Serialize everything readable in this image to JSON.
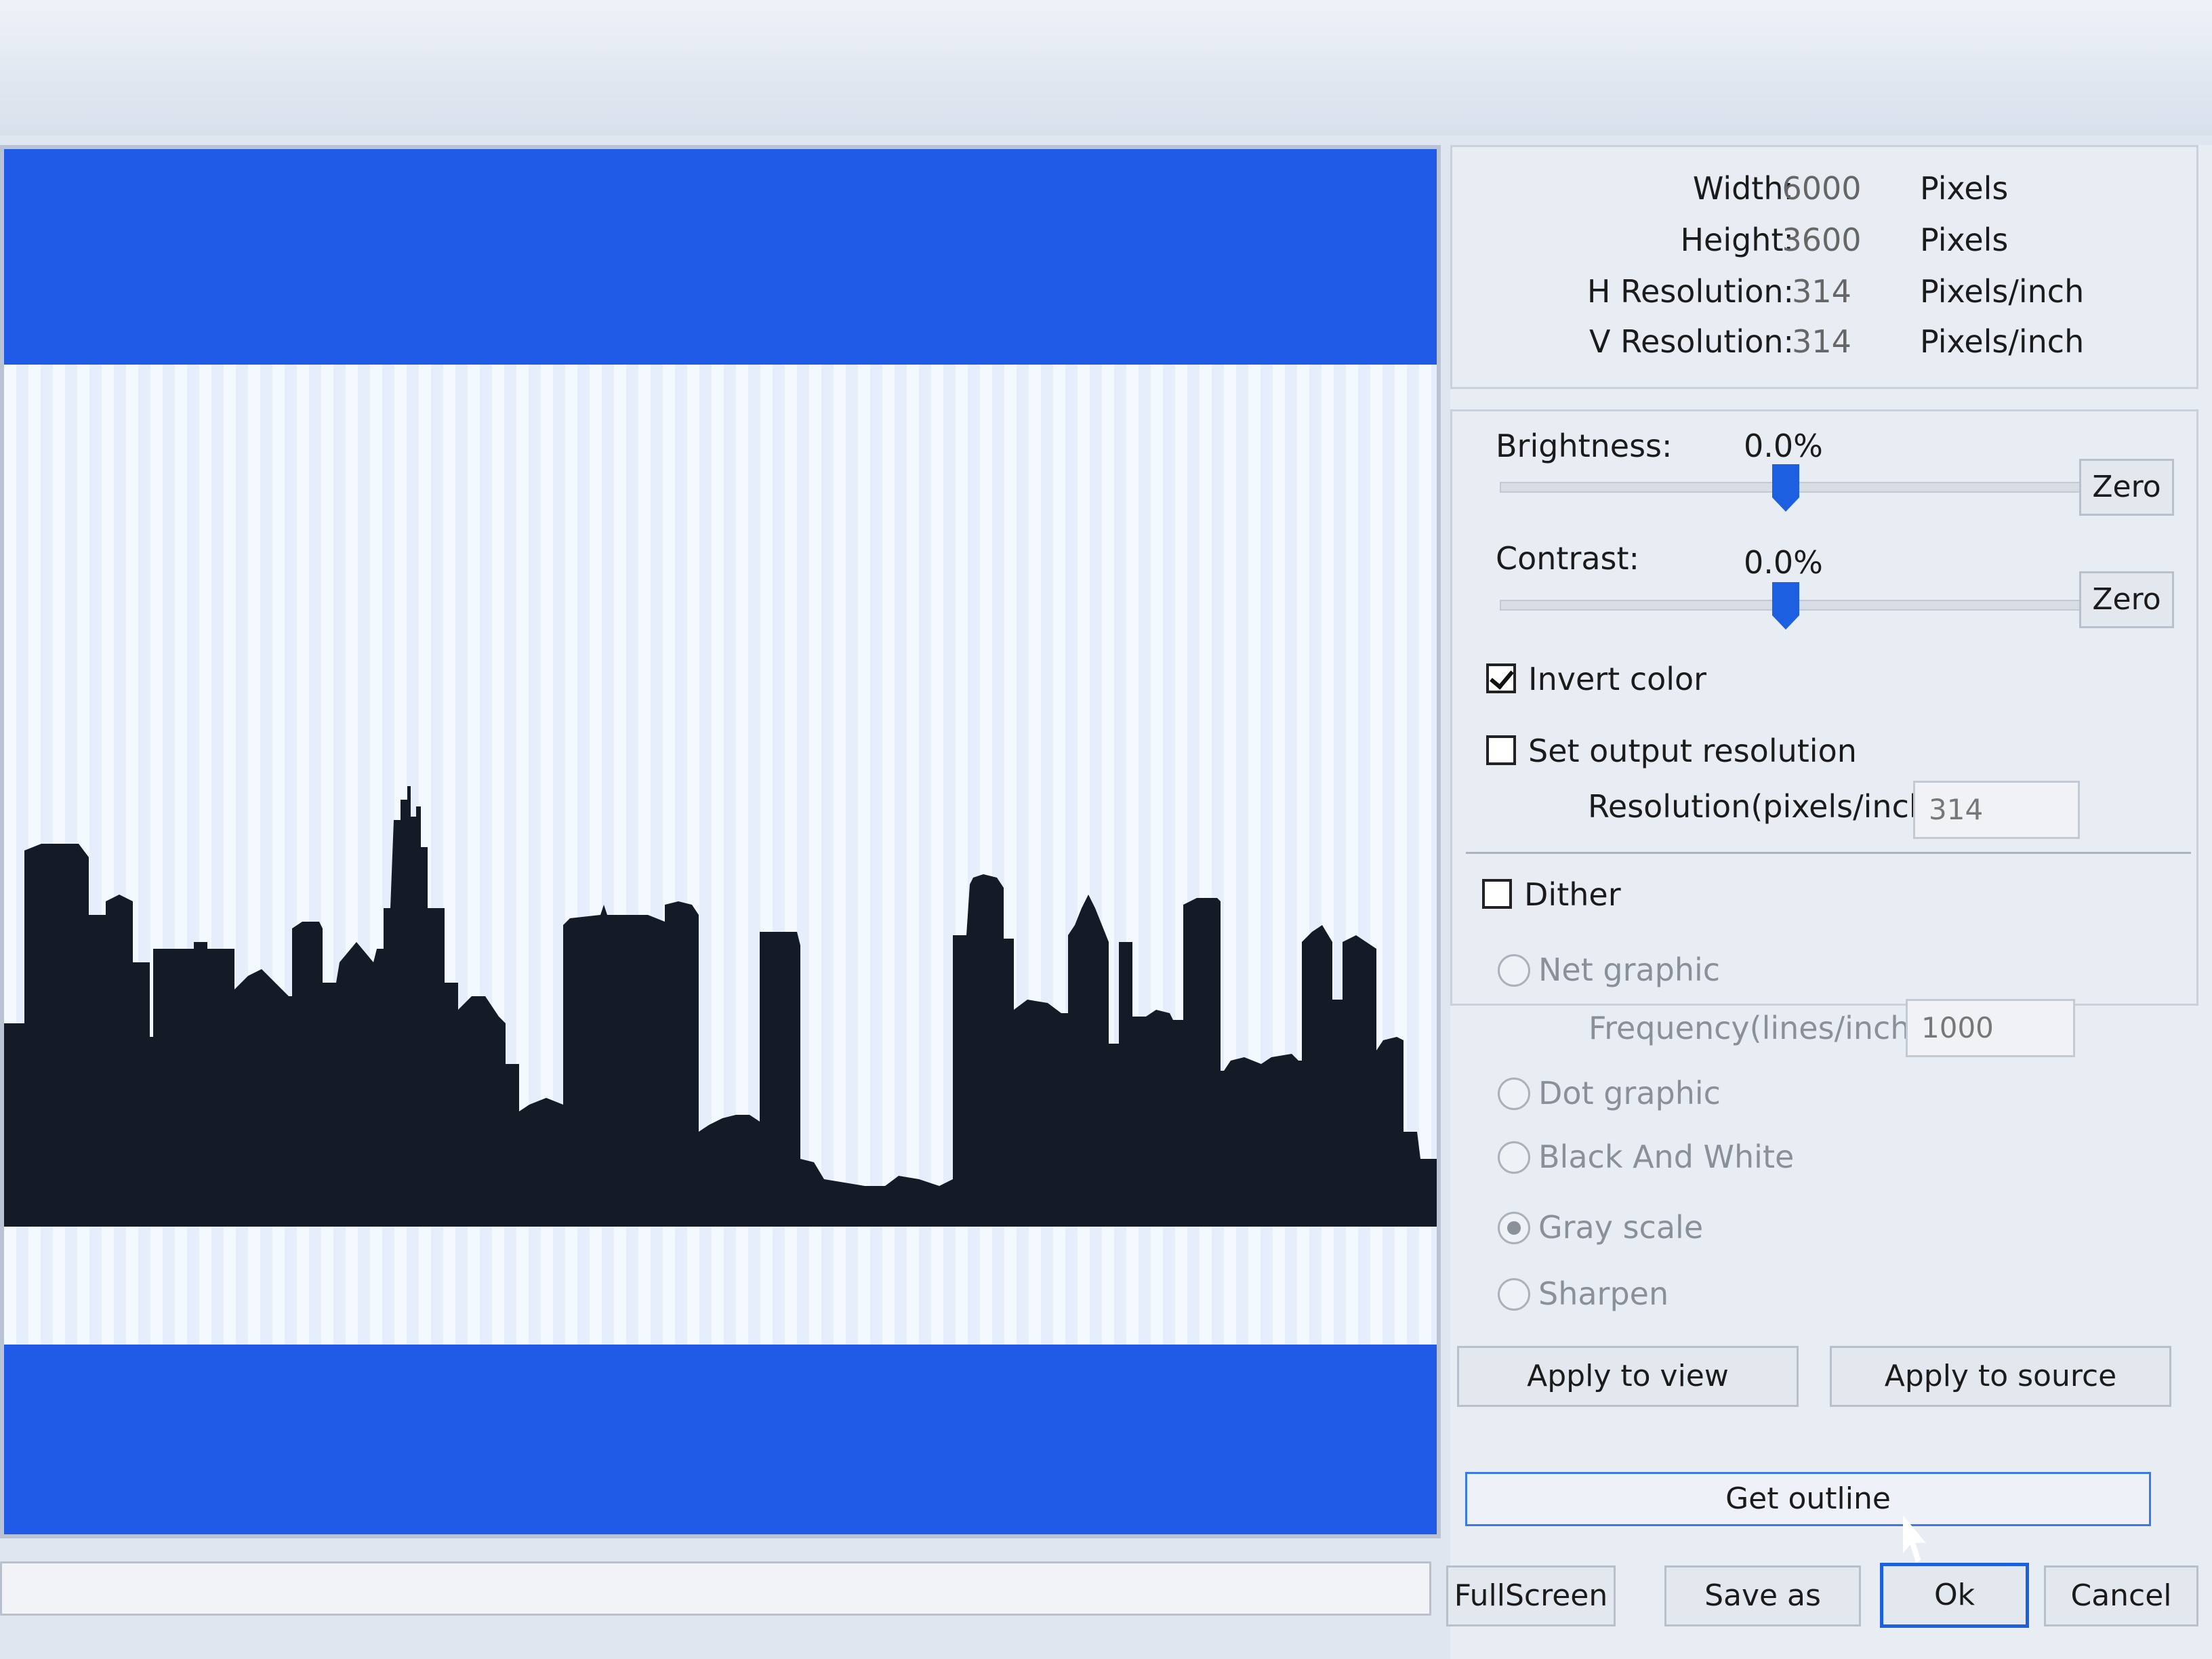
{
  "image_info": {
    "rows": [
      {
        "label": "Width:",
        "value": "6000",
        "unit": "Pixels"
      },
      {
        "label": "Height:",
        "value": "3600",
        "unit": "Pixels"
      },
      {
        "label": "H Resolution:",
        "value": "314",
        "unit": "Pixels/inch"
      },
      {
        "label": "V Resolution:",
        "value": "314",
        "unit": "Pixels/inch"
      }
    ]
  },
  "adjustments": {
    "brightness_label": "Brightness:",
    "brightness_value": "0.0%",
    "brightness_level": 0.0,
    "contrast_label": "Contrast:",
    "contrast_value": "0.0%",
    "contrast_level": 0.0,
    "zero_label": "Zero"
  },
  "options": {
    "invert_color": {
      "label": "Invert color",
      "checked": true
    },
    "set_output_resolution": {
      "label": "Set output resolution",
      "checked": false
    },
    "resolution_label": "Resolution(pixels/inch)",
    "resolution_value": "314",
    "dither": {
      "label": "Dither",
      "checked": false
    },
    "net_graphic_label": "Net graphic",
    "frequency_label": "Frequency(lines/inch):",
    "frequency_value": "1000",
    "dot_graphic_label": "Dot graphic",
    "black_and_white_label": "Black And White",
    "gray_scale_label": "Gray scale",
    "sharpen_label": "Sharpen"
  },
  "actions": {
    "apply_to_view": "Apply to view",
    "apply_to_source": "Apply to source",
    "get_outline": "Get outline",
    "fullscreen": "FullScreen",
    "save_as": "Save as",
    "ok": "Ok",
    "cancel": "Cancel"
  },
  "colors": {
    "accent": "#1f5be6",
    "silhouette": "#141a26"
  }
}
